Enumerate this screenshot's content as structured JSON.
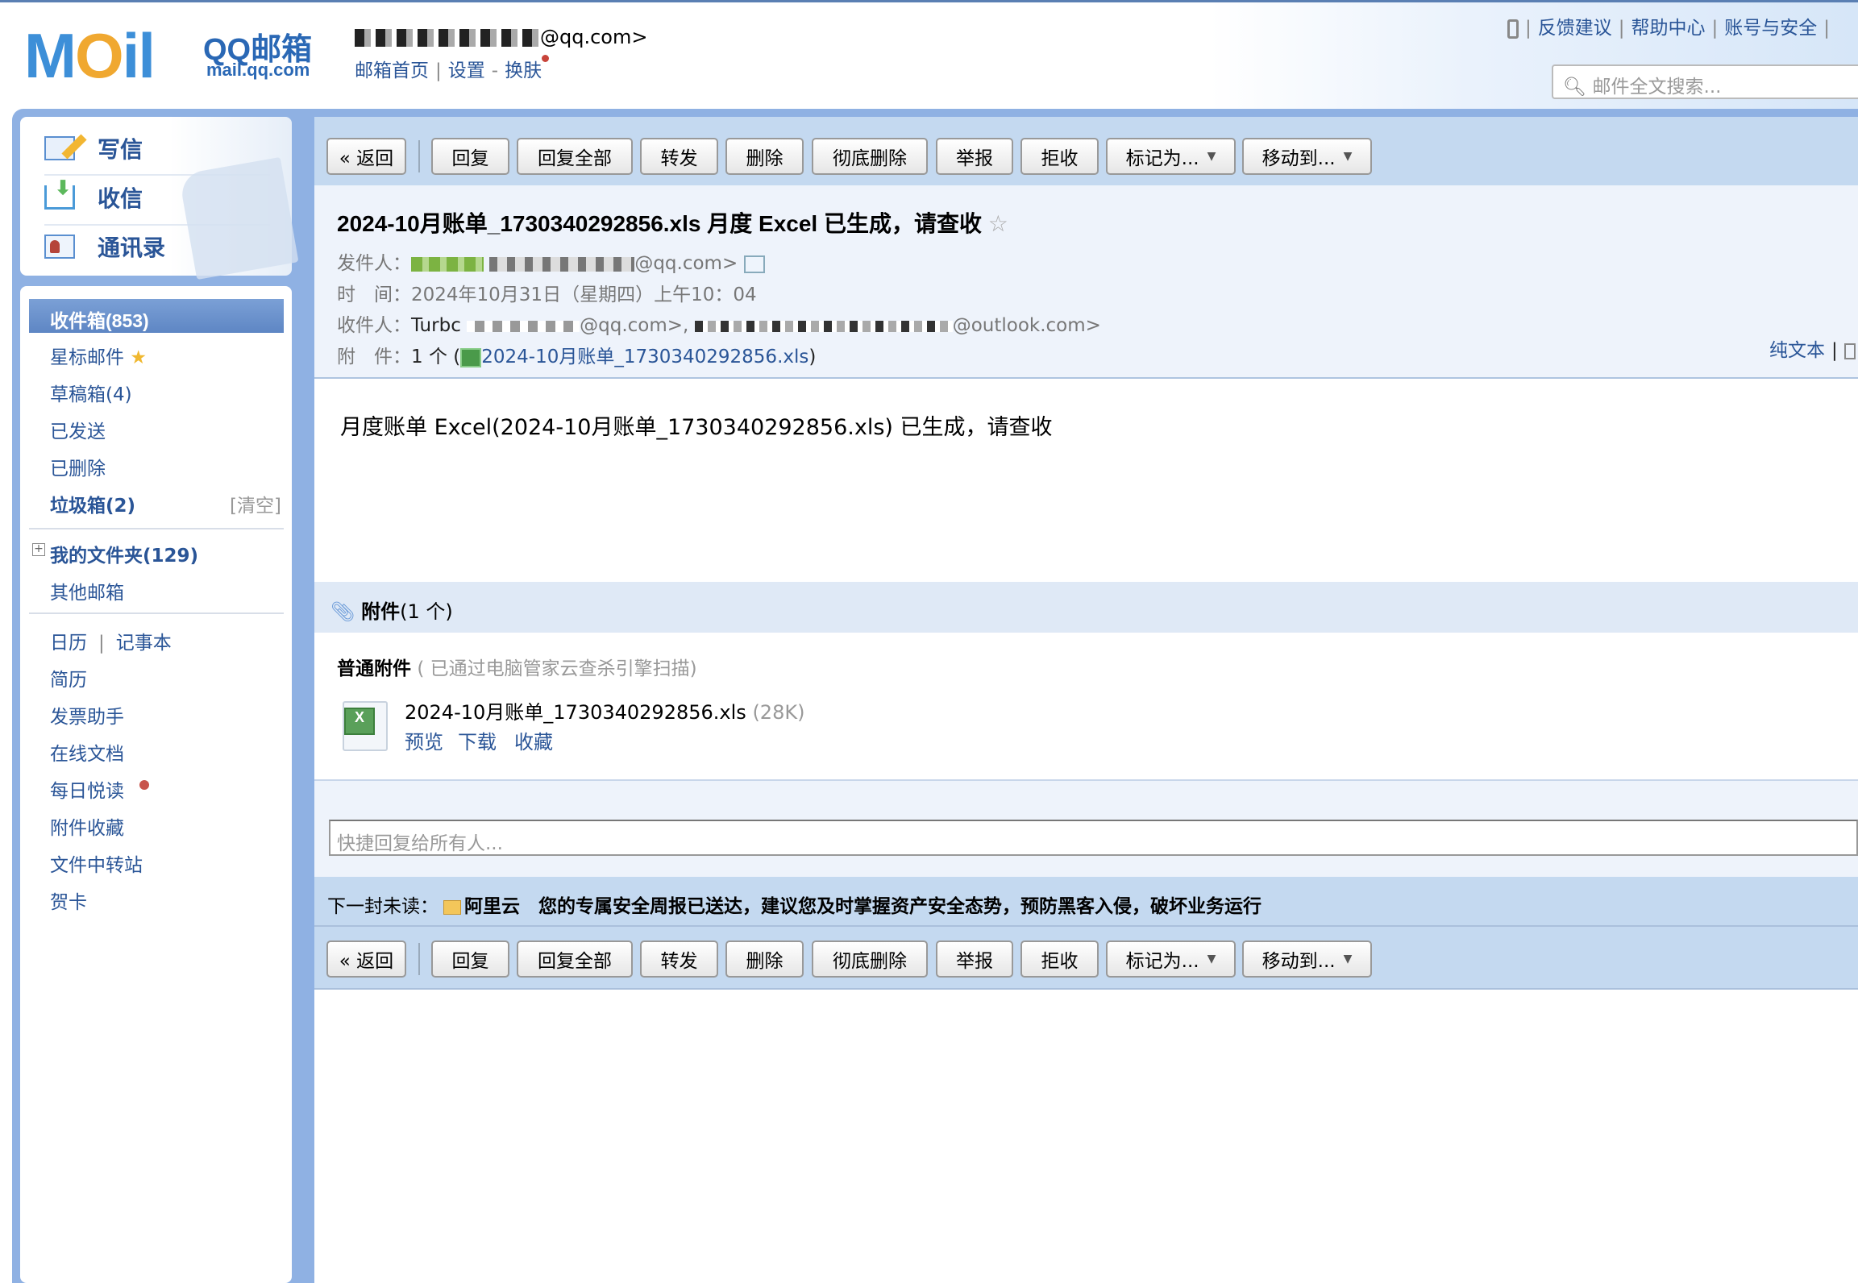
{
  "header": {
    "logo_text": "MOil",
    "logo_brand": "QQ邮箱",
    "logo_url": "mail.qq.com",
    "user_email_suffix": "@qq.com>",
    "links": [
      "邮箱首页",
      "设置",
      "换肤"
    ],
    "right_links": [
      "反馈建议",
      "帮助中心",
      "账号与安全"
    ],
    "search_placeholder": "邮件全文搜索..."
  },
  "sidebar": {
    "actions": [
      {
        "label": "写信",
        "icon": "compose-icon"
      },
      {
        "label": "收信",
        "icon": "inbox-download-icon"
      },
      {
        "label": "通讯录",
        "icon": "contacts-icon"
      }
    ],
    "folders": [
      {
        "label": "收件箱(853)",
        "active": true
      },
      {
        "label": "星标邮件"
      },
      {
        "label": "草稿箱(4)"
      },
      {
        "label": "已发送"
      },
      {
        "label": "已删除"
      },
      {
        "label": "垃圾箱(2)",
        "action": "[清空]"
      }
    ],
    "my_folders": "我的文件夹(129)",
    "other_mailbox": "其他邮箱",
    "calendar": "日历",
    "notepad": "记事本",
    "apps": [
      "简历",
      "发票助手",
      "在线文档",
      "每日悦读",
      "附件收藏",
      "文件中转站",
      "贺卡"
    ]
  },
  "toolbar": {
    "back": "« 返回",
    "buttons": [
      "回复",
      "回复全部",
      "转发",
      "删除",
      "彻底删除",
      "举报",
      "拒收"
    ],
    "mark_as": "标记为...",
    "move_to": "移动到..."
  },
  "email": {
    "subject": "2024-10月账单_1730340292856.xls 月度 Excel 已生成，请查收",
    "from_label": "发件人：",
    "from_value": "@qq.com>",
    "time_label": "时　间：",
    "time_value": "2024年10月31日（星期四）上午10：04",
    "to_label": "收件人：",
    "to_name": "Turbc",
    "to_addr1": "@qq.com>,",
    "to_addr2": "@outlook.com>",
    "att_label": "附　件：",
    "att_count": "1 个 (",
    "att_link": "2024-10月账单_1730340292856.xls",
    "att_close": ")",
    "plain_text": "纯文本",
    "body": "月度账单 Excel(2024-10月账单_1730340292856.xls) 已生成，请查收"
  },
  "attachments": {
    "title": "附件",
    "count": "(1 个)",
    "type_label": "普通附件",
    "scan_note": "( 已通过电脑管家云查杀引擎扫描)",
    "file_name": "2024-10月账单_1730340292856.xls",
    "file_size": "(28K)",
    "actions": [
      "预览",
      "下载",
      "收藏"
    ]
  },
  "quick_reply_placeholder": "快捷回复给所有人...",
  "next_unread": {
    "label": "下一封未读：",
    "sender": "阿里云",
    "subject": "您的专属安全周报已送达，建议您及时掌握资产安全态势，预防黑客入侵，破坏业务运行"
  }
}
